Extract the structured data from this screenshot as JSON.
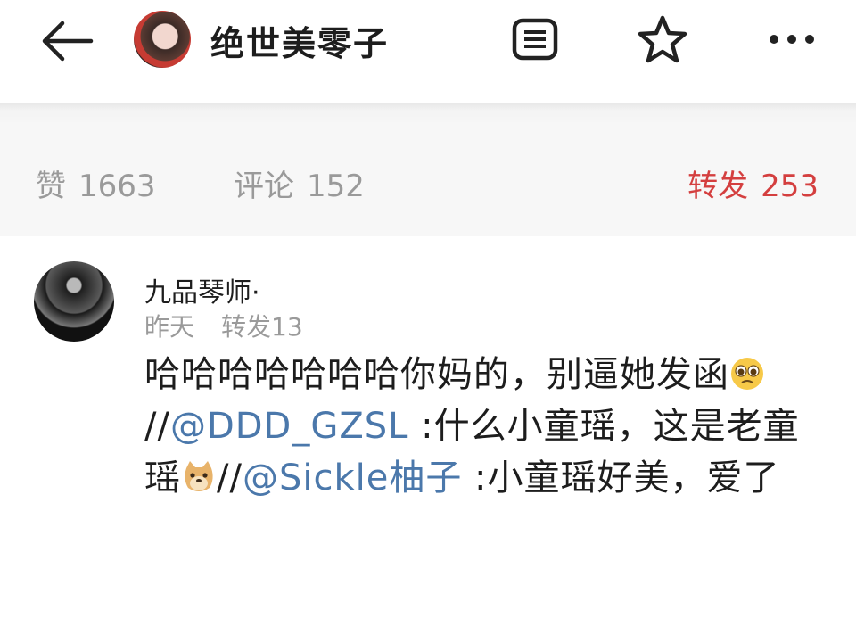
{
  "header": {
    "title": "绝世美零子"
  },
  "stats": {
    "likes_label": "赞",
    "likes_count": "1663",
    "comments_label": "评论",
    "comments_count": "152",
    "reposts_label": "转发",
    "reposts_count": "253"
  },
  "comment": {
    "username": "九品琴师·",
    "time": "昨天",
    "repost_count": "转发13",
    "text_part1": "哈哈哈哈哈哈哈你妈的，别逼她发函",
    "sep1": "//",
    "mention1": "@DDD_GZSL",
    "text_part2": " :什么小童瑶，这是老童瑶",
    "sep2": "//",
    "mention2": "@Sickle柚子",
    "text_part3": " :小童瑶好美，爱了"
  },
  "icons": {
    "back": "back-arrow-icon",
    "list": "list-icon",
    "star": "star-icon",
    "more": "more-icon",
    "emoji1": "pleading-face-emoji",
    "emoji2": "doge-emoji"
  },
  "colors": {
    "mention": "#4b78ab",
    "repost_active": "#d43f3f",
    "muted": "#9a9a9a"
  }
}
